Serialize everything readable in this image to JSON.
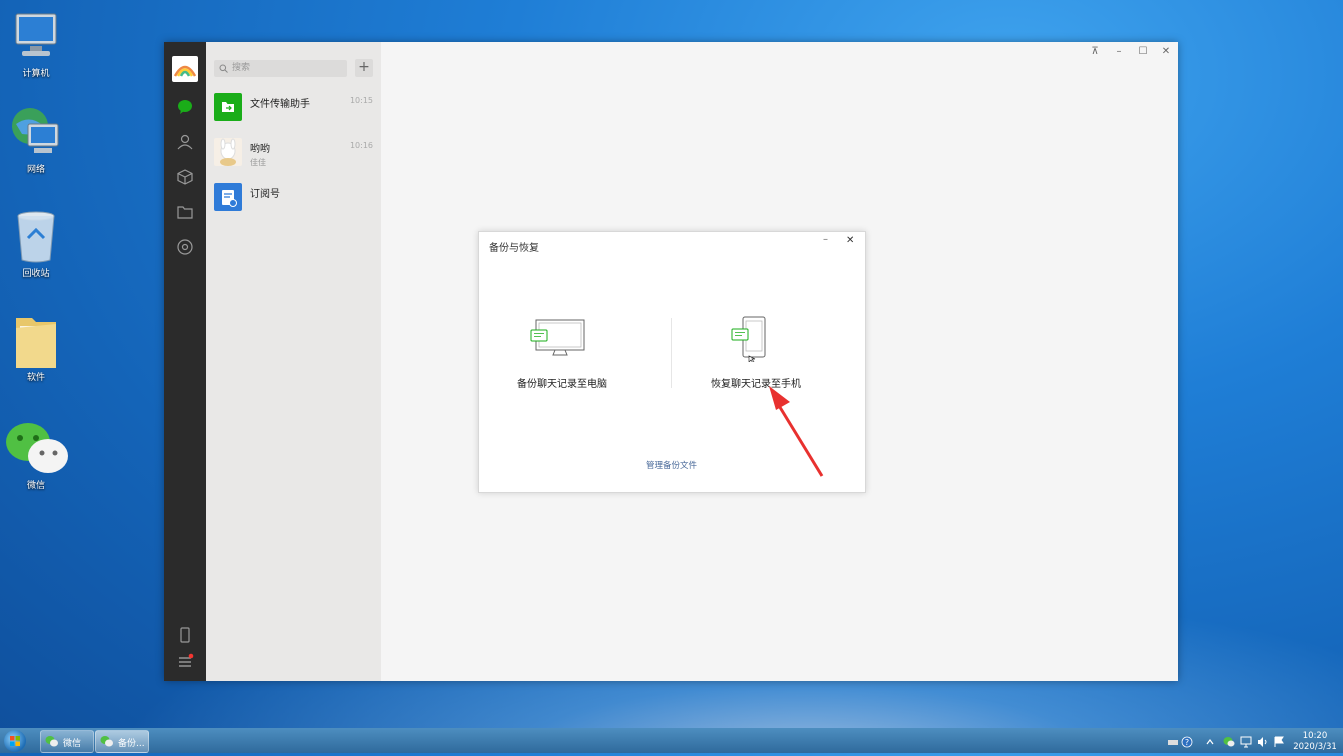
{
  "desktop": {
    "icons": [
      {
        "label": "计算机"
      },
      {
        "label": "网络"
      },
      {
        "label": "回收站"
      },
      {
        "label": "软件"
      },
      {
        "label": "微信"
      }
    ]
  },
  "wechat": {
    "search_placeholder": "搜索",
    "add_label": "+",
    "chats": [
      {
        "name": "文件传输助手",
        "time": "10:15",
        "preview": ""
      },
      {
        "name": "哟哟",
        "time": "10:16",
        "preview": "佳佳"
      },
      {
        "name": "订阅号",
        "time": "",
        "preview": ""
      }
    ],
    "window_controls": {
      "pin": "⊼",
      "minimize": "–",
      "maximize": "☐",
      "close": "✕"
    }
  },
  "dialog": {
    "title": "备份与恢复",
    "minimize": "–",
    "close": "✕",
    "backup_label": "备份聊天记录至电脑",
    "restore_label": "恢复聊天记录至手机",
    "manage_link": "管理备份文件"
  },
  "taskbar": {
    "buttons": [
      {
        "label": "微信"
      },
      {
        "label": "备份..."
      }
    ],
    "clock_time": "10:20",
    "clock_date": "2020/3/31"
  },
  "colors": {
    "wechat_green": "#1aad19",
    "arrow_red": "#e8312f",
    "nav_bg": "#2b2b2b"
  }
}
